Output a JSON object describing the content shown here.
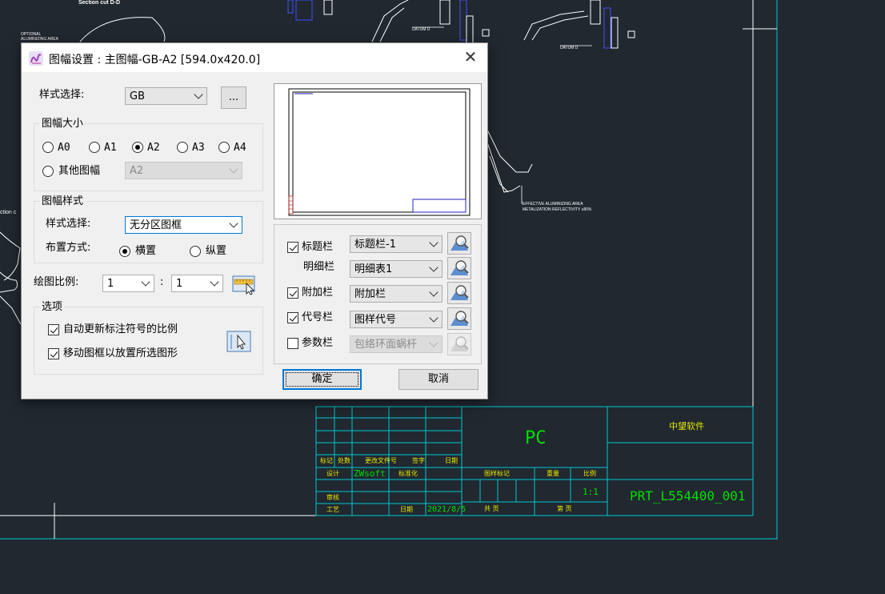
{
  "drawing": {
    "labels": {
      "section_cut": "Section cut D-D",
      "optional_area": "OPTIONAL",
      "optional_area2": "ALUMINIZING AREA",
      "datum_d1": "DATUM D",
      "datum_d2": "DATUM D",
      "effective_area": "EFFECTIVE ALUMINIZING AREA",
      "metalization": "METALIZATION REFLECTIVITY ≥80%",
      "section_side": "ction c"
    },
    "title_block": {
      "header_row": [
        "标记",
        "处数",
        "更改文件号",
        "签字",
        "日期"
      ],
      "designer_label": "设计",
      "designer_value": "ZWsoft",
      "standardization_label": "标准化",
      "reviewer_label": "审核",
      "process_label": "工艺",
      "date_label": "日期",
      "date_value": "2021/8/5",
      "stage_label": "图样标记",
      "weight_label": "重量",
      "scale_label": "比例",
      "scale_value": "1:1",
      "total_label": "共    页",
      "page_label": "第    页",
      "material": "PC",
      "company": "中望软件",
      "drawing_number": "PRT_L554400_001"
    }
  },
  "dialog": {
    "title": "图幅设置 : 主图幅-GB-A2 [594.0x420.0]",
    "style_select_label": "样式选择:",
    "style_select_value": "GB",
    "browse_button": "...",
    "frame_size_group": "图幅大小",
    "sizes": [
      "A0",
      "A1",
      "A2",
      "A3",
      "A4"
    ],
    "selected_size": "A2",
    "other_size_label": "其他图幅",
    "other_size_value": "A2",
    "frame_style_group": "图幅样式",
    "frame_style_label": "样式选择:",
    "frame_style_value": "无分区图框",
    "layout_label": "布置方式:",
    "layout_options": [
      "横置",
      "纵置"
    ],
    "selected_layout": "横置",
    "scale_label": "绘图比例:",
    "scale_left": "1",
    "scale_sep": ":",
    "scale_right": "1",
    "options_group": "选项",
    "option_update_scale": "自动更新标注符号的比例",
    "option_move_frame": "移动图框以放置所选图形",
    "components": [
      {
        "label": "标题栏",
        "checked": true,
        "value": "标题栏-1",
        "enabled": true,
        "has_checkbox": true
      },
      {
        "label": "明细栏",
        "checked": false,
        "value": "明细表1",
        "enabled": true,
        "has_checkbox": false
      },
      {
        "label": "附加栏",
        "checked": true,
        "value": "附加栏",
        "enabled": true,
        "has_checkbox": true
      },
      {
        "label": "代号栏",
        "checked": true,
        "value": "图样代号",
        "enabled": true,
        "has_checkbox": true
      },
      {
        "label": "参数栏",
        "checked": false,
        "value": "包络环面蜗杆",
        "enabled": false,
        "has_checkbox": true
      }
    ],
    "ok_button": "确定",
    "cancel_button": "取消"
  },
  "colors": {
    "background": "#212830",
    "cyan_line": "#00c8d0",
    "title_yellow": "#e8e800",
    "title_green": "#00e000",
    "accent": "#0078d7"
  }
}
